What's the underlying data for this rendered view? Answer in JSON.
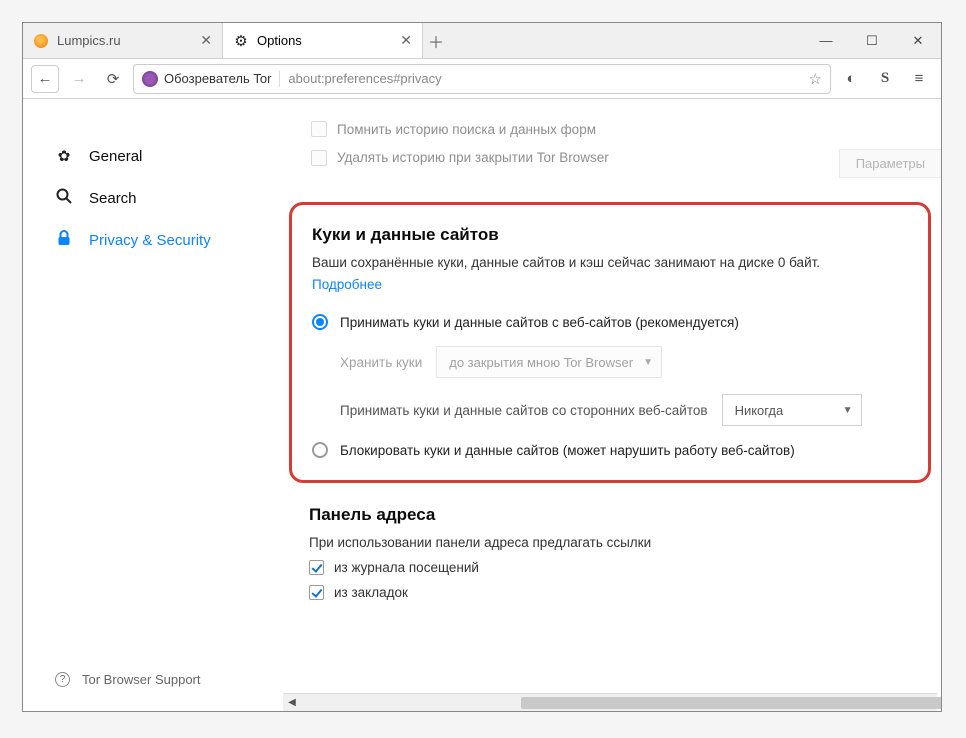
{
  "tabs": {
    "bg_title": "Lumpics.ru",
    "active_title": "Options"
  },
  "addr": {
    "label": "Обозреватель Tor",
    "url": "about:preferences#privacy"
  },
  "sidebar": {
    "general": "General",
    "search": "Search",
    "privacy": "Privacy & Security",
    "support": "Tor Browser Support"
  },
  "history": {
    "remember": "Помнить историю поиска и данных форм",
    "clear": "Удалять историю при закрытии Tor Browser",
    "params_btn": "Параметры"
  },
  "cookies": {
    "title": "Куки и данные сайтов",
    "desc": "Ваши сохранённые куки, данные сайтов и кэш сейчас занимают на диске 0 байт.",
    "link": "Подробнее",
    "radio_accept": "Принимать куки и данные сайтов с веб-сайтов (рекомендуется)",
    "keep_label": "Хранить куки",
    "keep_value": "до закрытия мною Tor Browser",
    "third_label": "Принимать куки и данные сайтов со сторонних веб-сайтов",
    "third_value": "Никогда",
    "radio_block": "Блокировать куки и данные сайтов (может нарушить работу веб-сайтов)"
  },
  "addrbar": {
    "title": "Панель адреса",
    "desc": "При использовании панели адреса предлагать ссылки",
    "opt1": "из журнала посещений",
    "opt2": "из закладок"
  }
}
